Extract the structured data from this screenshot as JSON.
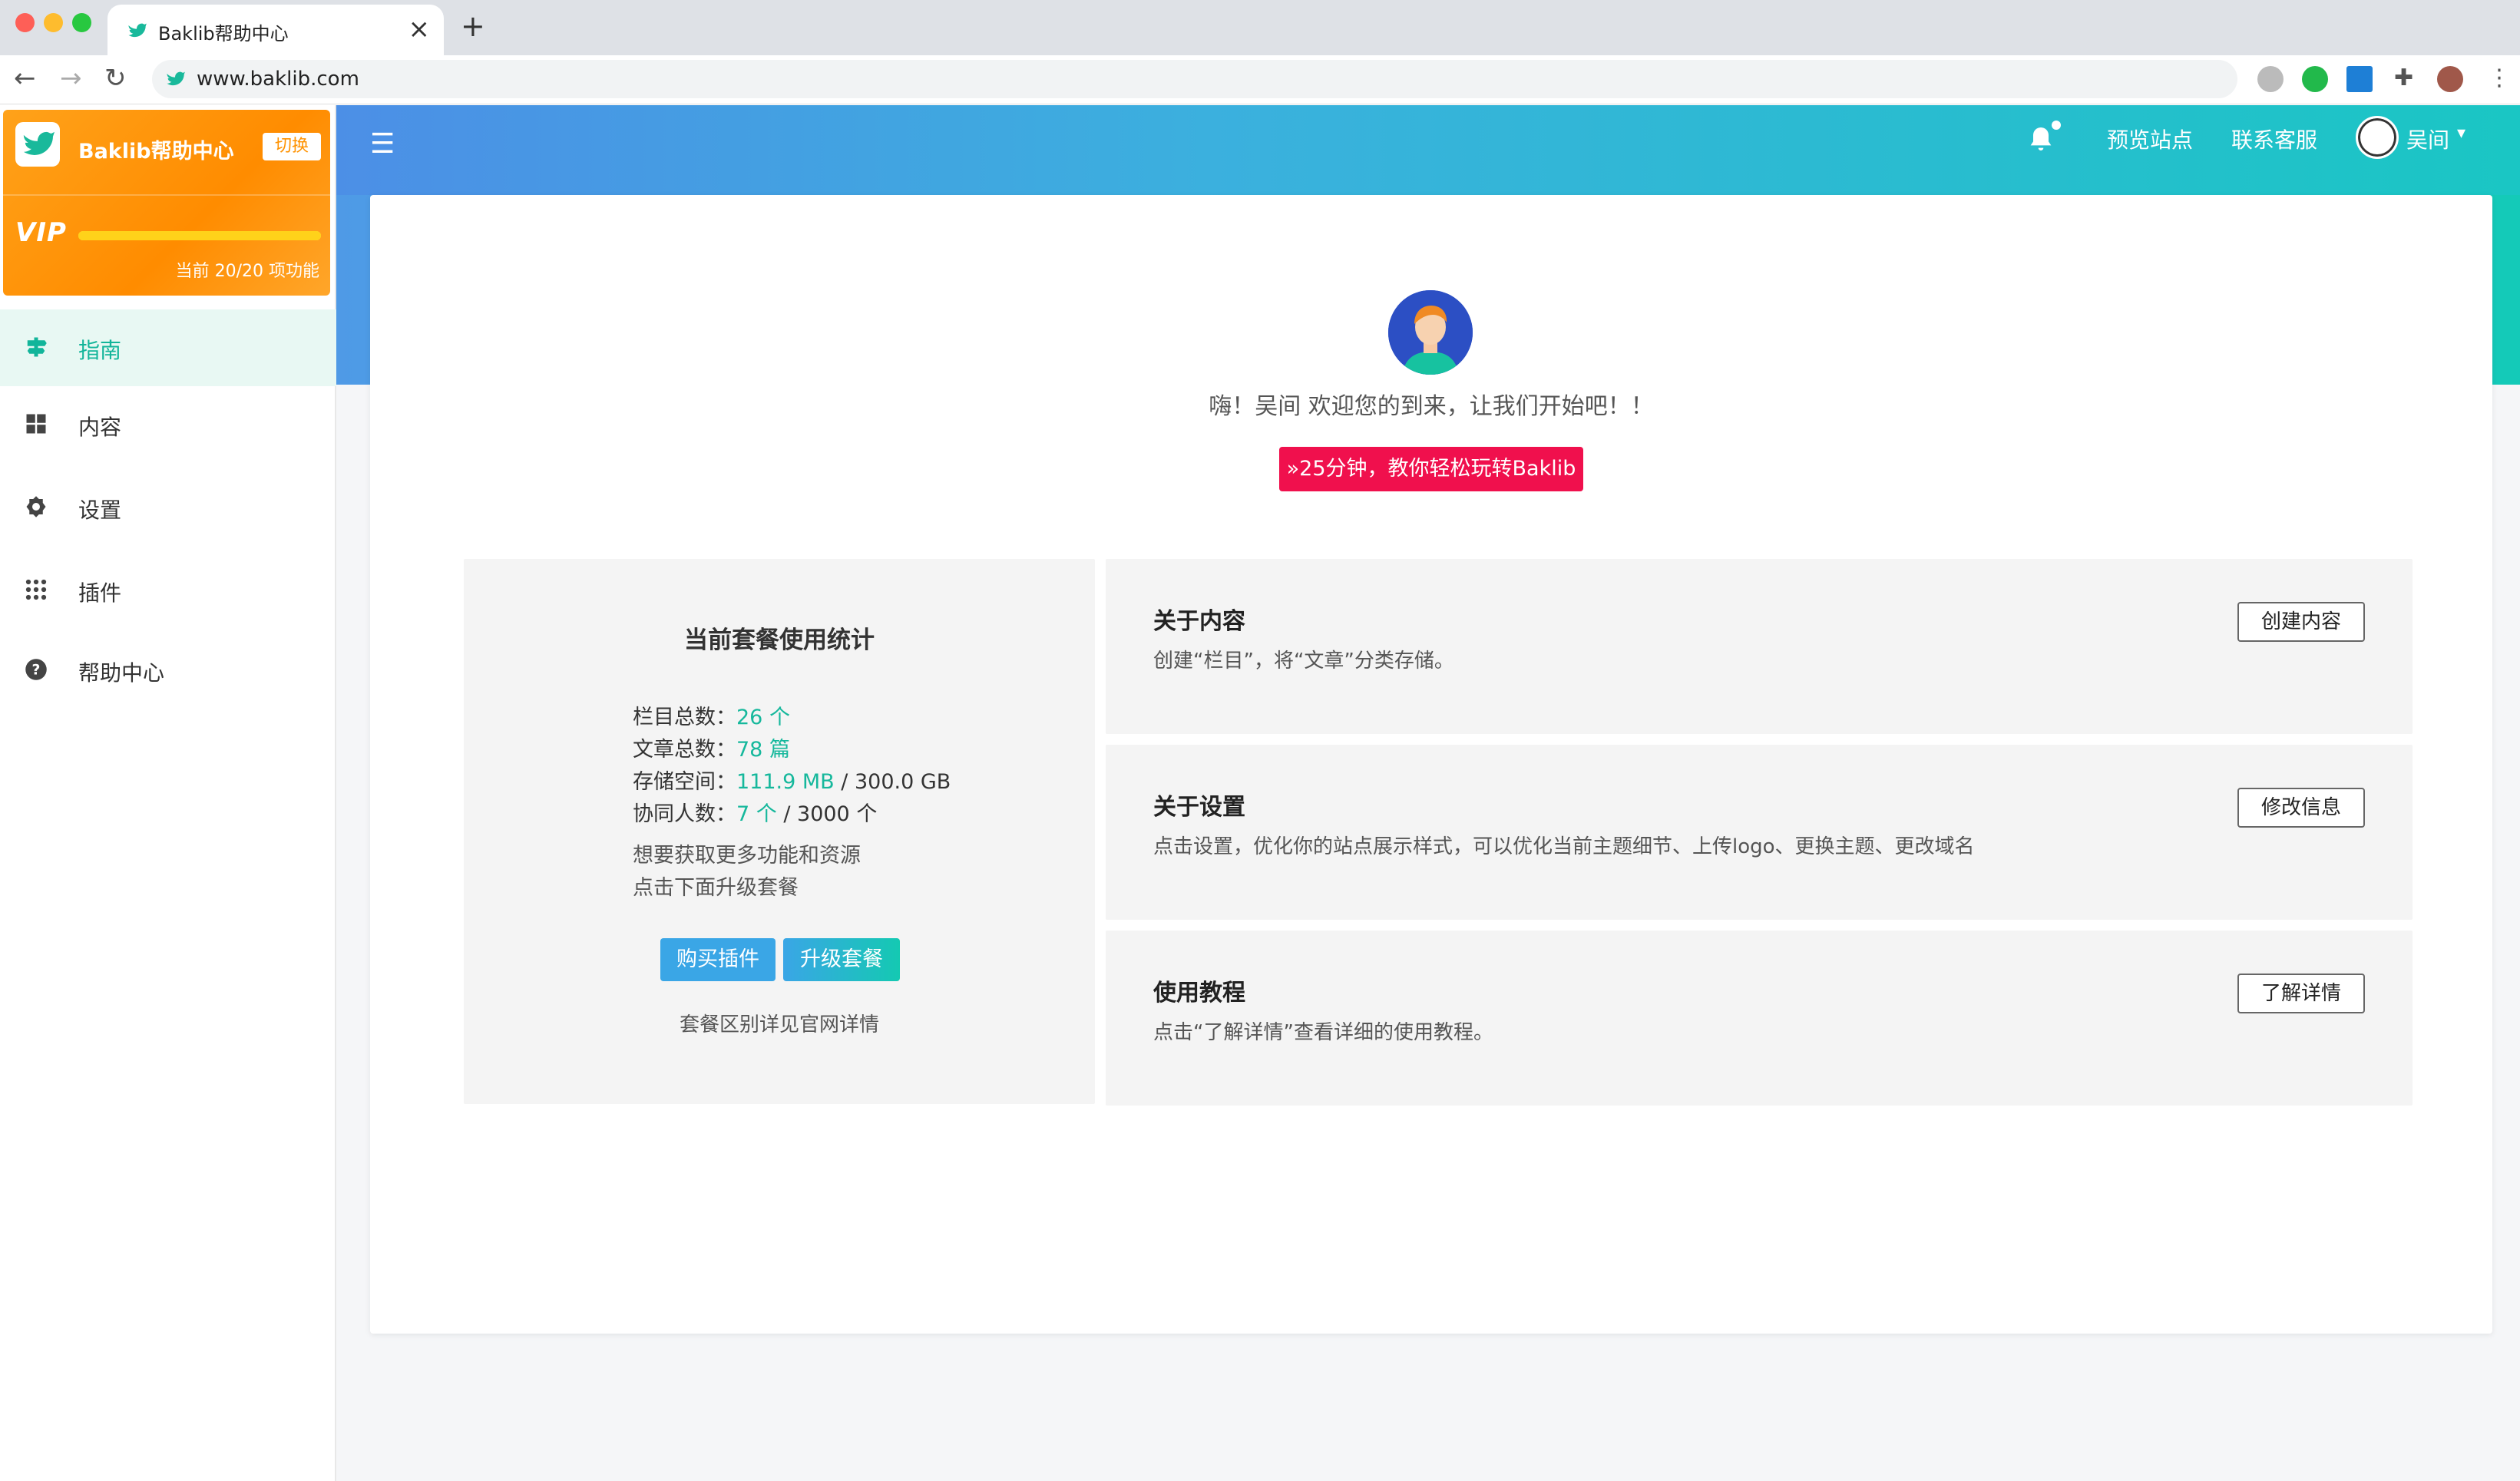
{
  "browser": {
    "tab_title": "Baklib帮助中心",
    "url": "www.baklib.com"
  },
  "header": {
    "preview_site": "预览站点",
    "contact_support": "联系客服",
    "user_name": "吴间"
  },
  "sidebar": {
    "site_title": "Baklib帮助中心",
    "switch_label": "切换",
    "vip_label": "VIP",
    "vip_usage": "当前 20/20 项功能",
    "vip_progress": 1.0,
    "items": [
      {
        "label": "指南",
        "icon": "guide-icon",
        "active": true
      },
      {
        "label": "内容",
        "icon": "grid-icon",
        "active": false
      },
      {
        "label": "设置",
        "icon": "gear-icon",
        "active": false
      },
      {
        "label": "插件",
        "icon": "apps-icon",
        "active": false
      },
      {
        "label": "帮助中心",
        "icon": "help-icon",
        "active": false
      }
    ]
  },
  "main": {
    "welcome": "嗨！吴间 欢迎您的到来，让我们开始吧！！",
    "tutorial_button": "»25分钟，教你轻松玩转Baklib",
    "stats": {
      "title": "当前套餐使用统计",
      "rows": [
        {
          "label": "栏目总数：",
          "value": "26 个",
          "limit": ""
        },
        {
          "label": "文章总数：",
          "value": "78 篇",
          "limit": ""
        },
        {
          "label": "存储空间：",
          "value": "111.9 MB",
          "limit": " / 300.0 GB"
        },
        {
          "label": "协同人数：",
          "value": "7 个",
          "limit": " / 3000 个"
        }
      ],
      "hint1": "想要获取更多功能和资源",
      "hint2": "点击下面升级套餐",
      "buy_plugin": "购买插件",
      "upgrade": "升级套餐",
      "note": "套餐区别详见官网详情"
    },
    "cards": [
      {
        "title": "关于内容",
        "desc": "创建“栏目”，将“文章”分类存储。",
        "button": "创建内容"
      },
      {
        "title": "关于设置",
        "desc": "点击设置，优化你的站点展示样式，可以优化当前主题细节、上传logo、更换主题、更改域名",
        "button": "修改信息"
      },
      {
        "title": "使用教程",
        "desc": "点击“了解详情”查看详细的使用教程。",
        "button": "了解详情"
      }
    ]
  },
  "colors": {
    "accent": "#12b59a",
    "vip_orange": "#ff9200",
    "tutorial_red": "#f0104d"
  }
}
